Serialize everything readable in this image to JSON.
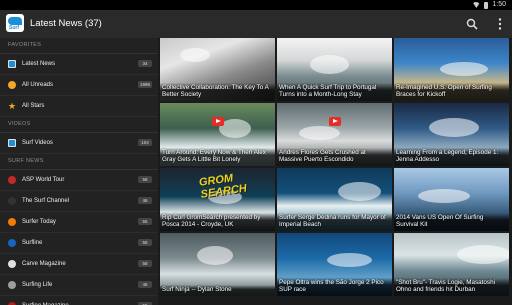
{
  "status": {
    "time": "1:50"
  },
  "app": {
    "title": "Latest News (37)"
  },
  "drawer": {
    "sections": [
      {
        "header": "FAVORITES",
        "items": [
          {
            "label": "Latest News",
            "badge": "34",
            "icon": "rss-icon"
          },
          {
            "label": "All Unreads",
            "badge": "1996",
            "icon": "dot-icon"
          },
          {
            "label": "All Stars",
            "badge": "",
            "icon": "star-icon"
          }
        ]
      },
      {
        "header": "VIDEOS",
        "items": [
          {
            "label": "Surf Videos",
            "badge": "104",
            "icon": "rss-icon"
          }
        ]
      },
      {
        "header": "SURF NEWS",
        "items": [
          {
            "label": "ASP World Tour",
            "badge": "58",
            "icon": "site-icon",
            "color": "#c62828"
          },
          {
            "label": "The Surf Channel",
            "badge": "46",
            "icon": "site-icon",
            "color": "#333333"
          },
          {
            "label": "Surfer Today",
            "badge": "55",
            "icon": "site-icon",
            "color": "#f57c00"
          },
          {
            "label": "Surfline",
            "badge": "58",
            "icon": "site-icon",
            "color": "#1565c0"
          },
          {
            "label": "Carve Magazine",
            "badge": "58",
            "icon": "site-icon",
            "color": "#e0e0e0"
          },
          {
            "label": "Surfing Life",
            "badge": "46",
            "icon": "site-icon",
            "color": "#9e9e9e"
          },
          {
            "label": "Surfing Magazine",
            "badge": "55",
            "icon": "site-icon",
            "color": "#b71c1c"
          }
        ]
      }
    ]
  },
  "tiles": [
    {
      "caption": "Collective Collaboration: The Key To A Better Society",
      "video": false
    },
    {
      "caption": "When A Quick Surf Trip to Portugal Turns into a Month-Long Stay",
      "video": false
    },
    {
      "caption": "Re-Imagined U.S. Open of Surfing Braces for Kickoff",
      "video": false
    },
    {
      "caption": "Turn Around: Every Now & Then Alex Gray Gets A Little Bit Lonely",
      "video": true
    },
    {
      "caption": "Andres Flores Gets Crushed at Massive Puerto Escondido",
      "video": true
    },
    {
      "caption": "Learning From a Legend, Episode 1: Jenna Addesso",
      "video": false
    },
    {
      "caption": "Rip Curl GromSearch presented by Posca 2014 - Croyde, UK",
      "video": false,
      "overlay": [
        "GROM",
        "SEARCH"
      ]
    },
    {
      "caption": "Surfer Serge Dedina runs for Mayor of Imperial Beach",
      "video": false
    },
    {
      "caption": "2014 Vans US Open Of Surfing Survival Kit",
      "video": false
    },
    {
      "caption": "Surf Ninja -- Dylan Stone",
      "video": false
    },
    {
      "caption": "Pepe Oltra wins the São Jorge 2 Pico SUP race",
      "video": false
    },
    {
      "caption": "\"Shot Bru\"- Travis Logie, Masatoshi Ohno and friends hit Durban",
      "video": false
    }
  ]
}
